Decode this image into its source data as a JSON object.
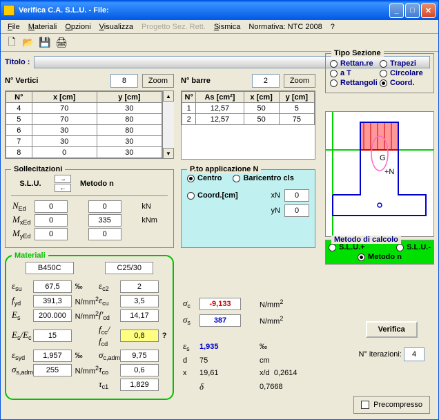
{
  "window": {
    "title": "Verifica C.A. S.L.U.  - File:"
  },
  "menu": {
    "file": "File",
    "materiali": "Materiali",
    "opzioni": "Opzioni",
    "visualizza": "Visualizza",
    "progetto": "Progetto Sez. Rett.",
    "sismica": "Sismica",
    "normativa": "Normativa: NTC 2008",
    "help": "?"
  },
  "titolo": {
    "label": "Titolo :"
  },
  "vertici": {
    "label": "N° Vertici",
    "value": "8",
    "zoom": "Zoom",
    "headers": [
      "N°",
      "x [cm]",
      "y [cm]"
    ],
    "rows": [
      [
        "4",
        "70",
        "30"
      ],
      [
        "5",
        "70",
        "80"
      ],
      [
        "6",
        "30",
        "80"
      ],
      [
        "7",
        "30",
        "30"
      ],
      [
        "8",
        "0",
        "30"
      ]
    ]
  },
  "barre": {
    "label": "N° barre",
    "value": "2",
    "zoom": "Zoom",
    "headers": [
      "N°",
      "As [cm²]",
      "x [cm]",
      "y [cm]"
    ],
    "rows": [
      [
        "1",
        "12,57",
        "50",
        "5"
      ],
      [
        "2",
        "12,57",
        "50",
        "75"
      ]
    ]
  },
  "sollecitazioni": {
    "title": "Sollecitazioni",
    "slu": "S.L.U.",
    "metodon": "Metodo n",
    "labels": {
      "NEd": "N",
      "NEd_sub": "Ed",
      "MxEd": "M",
      "MxEd_sub": "xEd",
      "MyEd": "M",
      "MyEd_sub": "yEd"
    },
    "vals": {
      "NEd": "0",
      "MxEd": "0",
      "MyEd": "0",
      "kN_N": "0",
      "kN_M": "335",
      "kN_My": "0"
    },
    "units": {
      "kN": "kN",
      "kNm": "kNm"
    }
  },
  "pto": {
    "title": "P.to applicazione N",
    "centro": "Centro",
    "baricentro": "Baricentro cls",
    "coord": "Coord.[cm]",
    "xN": "xN",
    "xN_val": "0",
    "yN": "yN",
    "yN_val": "0"
  },
  "tipo_sezione": {
    "title": "Tipo Sezione",
    "rettanre": "Rettan.re",
    "trapezi": "Trapezi",
    "aT": "a T",
    "circolare": "Circolare",
    "rettangoli": "Rettangoli",
    "coord": "Coord."
  },
  "metodo_calcolo": {
    "title": "Metodo di calcolo",
    "slup": "S.L.U.+",
    "slum": "S.L.U.-",
    "metodon": "Metodo n"
  },
  "materiali": {
    "title": "Materiali",
    "steel": "B450C",
    "conc": "C25/30",
    "labels": {
      "esu": "ε",
      "esu_sub": "su",
      "fyd": "f",
      "fyd_sub": "yd",
      "Es": "E",
      "Es_sub": "s",
      "EsEc": "E",
      "EsEc_sub": "s",
      "EsEc2": "/E",
      "EsEc2_sub": "c",
      "esyd": "ε",
      "esyd_sub": "syd",
      "ssadm": "σ",
      "ssadm_sub": "s,adm",
      "ec2": "ε",
      "ec2_sub": "c2",
      "ecu": "ε",
      "ecu_sub": "cu",
      "fcd": "f'",
      "fcd_sub": "cd",
      "fccfcd": "f",
      "fccfcd_sub": "cc",
      "fccfcd2": "/ f",
      "fccfcd2_sub": "cd",
      "scadm": "σ",
      "scadm_sub": "c,adm",
      "tco": "τ",
      "tco_sub": "co",
      "tc1": "τ",
      "tc1_sub": "c1"
    },
    "vals": {
      "esu": "67,5",
      "fyd": "391,3",
      "Es": "200.000",
      "EsEc": "15",
      "esyd": "1,957",
      "ssadm": "255",
      "ec2": "2",
      "ecu": "3,5",
      "fcd": "14,17",
      "fccfcd": "0,8",
      "scadm": "9,75",
      "tco": "0,6",
      "tc1": "1,829"
    },
    "units": {
      "permille": "‰",
      "Nmm2": "N/mm",
      "Nmm2_sup": "2"
    }
  },
  "results": {
    "sc": "σ",
    "sc_sub": "c",
    "sc_val": "-9,133",
    "ss": "σ",
    "ss_sub": "s",
    "ss_val": "387",
    "es": "ε",
    "es_sub": "s",
    "es_val": "1,935",
    "d": "d",
    "d_val": "75",
    "d_unit": "cm",
    "x": "x",
    "x_val": "19,61",
    "xd": "x/d",
    "xd_val": "0,2614",
    "delta": "δ",
    "delta_val": "0,7668"
  },
  "verifica": {
    "btn": "Verifica",
    "niter_label": "N° iterazioni:",
    "niter_val": "4"
  },
  "precompresso": "Precompresso"
}
